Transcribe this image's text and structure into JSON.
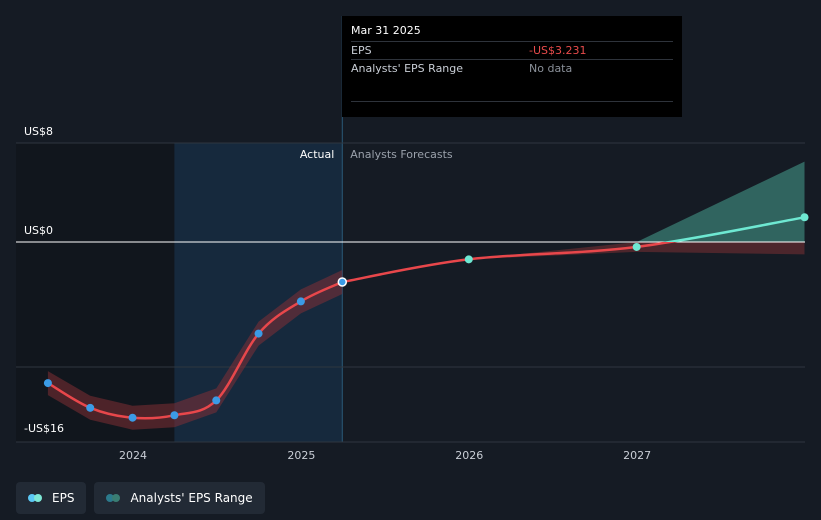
{
  "chart_data": {
    "type": "line",
    "y_ticks": [
      {
        "label": "US$8",
        "value": 8
      },
      {
        "label": "US$0",
        "value": 0
      },
      {
        "label": "-US$16",
        "value": -16
      }
    ],
    "ylim": [
      -16,
      8
    ],
    "x_ticks": [
      "2024",
      "2025",
      "2026",
      "2027"
    ],
    "actual_label": "Actual",
    "forecast_label": "Analysts Forecasts",
    "series": [
      {
        "name": "EPS",
        "color": "#e8474b",
        "points": [
          {
            "x": "2023-06-30",
            "y": -11.4
          },
          {
            "x": "2023-09-30",
            "y": -13.4
          },
          {
            "x": "2023-12-31",
            "y": -14.2
          },
          {
            "x": "2024-03-31",
            "y": -14.0
          },
          {
            "x": "2024-06-30",
            "y": -12.8
          },
          {
            "x": "2024-09-30",
            "y": -7.4
          },
          {
            "x": "2024-12-31",
            "y": -4.8
          },
          {
            "x": "2025-03-31",
            "y": -3.231
          }
        ]
      },
      {
        "name": "EPS forecast",
        "color": "#e8474b",
        "points": [
          {
            "x": "2025-03-31",
            "y": -3.231
          },
          {
            "x": "2025-12-31",
            "y": -1.4
          },
          {
            "x": "2026-12-31",
            "y": -0.4
          },
          {
            "x": "2027-12-31",
            "y": 2.0
          }
        ]
      }
    ],
    "range_band": {
      "name": "Analysts' EPS Range",
      "color": "#3a7d73",
      "points": [
        {
          "x": "2025-03-31",
          "low": -3.231,
          "high": -3.231
        },
        {
          "x": "2025-12-31",
          "low": -1.4,
          "high": -1.4
        },
        {
          "x": "2026-12-31",
          "low": -0.8,
          "high": 0.0
        },
        {
          "x": "2027-12-31",
          "low": -1.0,
          "high": 6.5
        }
      ]
    },
    "tooltip": {
      "date": "Mar 31 2025",
      "rows": [
        {
          "label": "EPS",
          "value": "-US$3.231",
          "negative": true
        },
        {
          "label": "Analysts' EPS Range",
          "value": "No data",
          "negative": false
        }
      ]
    },
    "legend": [
      {
        "label": "EPS",
        "colors": [
          "#5bc8f5",
          "#7ee8d6"
        ]
      },
      {
        "label": "Analysts' EPS Range",
        "colors": [
          "#2c7a8c",
          "#3a7d73"
        ]
      }
    ]
  }
}
